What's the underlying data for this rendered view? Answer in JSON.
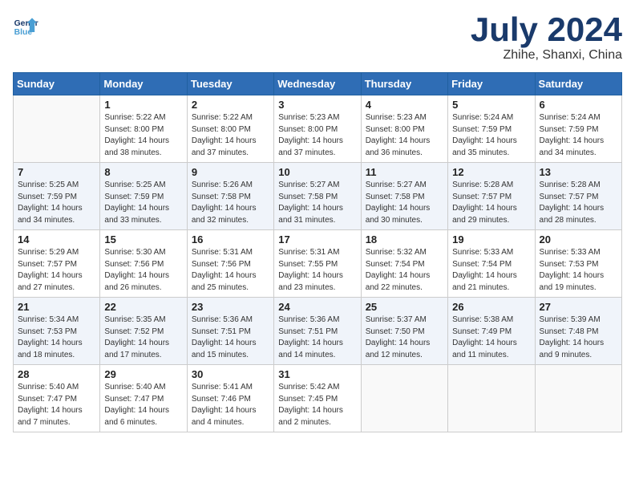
{
  "header": {
    "logo_line1": "General",
    "logo_line2": "Blue",
    "title": "July 2024",
    "subtitle": "Zhihe, Shanxi, China"
  },
  "days_of_week": [
    "Sunday",
    "Monday",
    "Tuesday",
    "Wednesday",
    "Thursday",
    "Friday",
    "Saturday"
  ],
  "weeks": [
    [
      {
        "day": "",
        "info": ""
      },
      {
        "day": "1",
        "info": "Sunrise: 5:22 AM\nSunset: 8:00 PM\nDaylight: 14 hours\nand 38 minutes."
      },
      {
        "day": "2",
        "info": "Sunrise: 5:22 AM\nSunset: 8:00 PM\nDaylight: 14 hours\nand 37 minutes."
      },
      {
        "day": "3",
        "info": "Sunrise: 5:23 AM\nSunset: 8:00 PM\nDaylight: 14 hours\nand 37 minutes."
      },
      {
        "day": "4",
        "info": "Sunrise: 5:23 AM\nSunset: 8:00 PM\nDaylight: 14 hours\nand 36 minutes."
      },
      {
        "day": "5",
        "info": "Sunrise: 5:24 AM\nSunset: 7:59 PM\nDaylight: 14 hours\nand 35 minutes."
      },
      {
        "day": "6",
        "info": "Sunrise: 5:24 AM\nSunset: 7:59 PM\nDaylight: 14 hours\nand 34 minutes."
      }
    ],
    [
      {
        "day": "7",
        "info": "Sunrise: 5:25 AM\nSunset: 7:59 PM\nDaylight: 14 hours\nand 34 minutes."
      },
      {
        "day": "8",
        "info": "Sunrise: 5:25 AM\nSunset: 7:59 PM\nDaylight: 14 hours\nand 33 minutes."
      },
      {
        "day": "9",
        "info": "Sunrise: 5:26 AM\nSunset: 7:58 PM\nDaylight: 14 hours\nand 32 minutes."
      },
      {
        "day": "10",
        "info": "Sunrise: 5:27 AM\nSunset: 7:58 PM\nDaylight: 14 hours\nand 31 minutes."
      },
      {
        "day": "11",
        "info": "Sunrise: 5:27 AM\nSunset: 7:58 PM\nDaylight: 14 hours\nand 30 minutes."
      },
      {
        "day": "12",
        "info": "Sunrise: 5:28 AM\nSunset: 7:57 PM\nDaylight: 14 hours\nand 29 minutes."
      },
      {
        "day": "13",
        "info": "Sunrise: 5:28 AM\nSunset: 7:57 PM\nDaylight: 14 hours\nand 28 minutes."
      }
    ],
    [
      {
        "day": "14",
        "info": "Sunrise: 5:29 AM\nSunset: 7:57 PM\nDaylight: 14 hours\nand 27 minutes."
      },
      {
        "day": "15",
        "info": "Sunrise: 5:30 AM\nSunset: 7:56 PM\nDaylight: 14 hours\nand 26 minutes."
      },
      {
        "day": "16",
        "info": "Sunrise: 5:31 AM\nSunset: 7:56 PM\nDaylight: 14 hours\nand 25 minutes."
      },
      {
        "day": "17",
        "info": "Sunrise: 5:31 AM\nSunset: 7:55 PM\nDaylight: 14 hours\nand 23 minutes."
      },
      {
        "day": "18",
        "info": "Sunrise: 5:32 AM\nSunset: 7:54 PM\nDaylight: 14 hours\nand 22 minutes."
      },
      {
        "day": "19",
        "info": "Sunrise: 5:33 AM\nSunset: 7:54 PM\nDaylight: 14 hours\nand 21 minutes."
      },
      {
        "day": "20",
        "info": "Sunrise: 5:33 AM\nSunset: 7:53 PM\nDaylight: 14 hours\nand 19 minutes."
      }
    ],
    [
      {
        "day": "21",
        "info": "Sunrise: 5:34 AM\nSunset: 7:53 PM\nDaylight: 14 hours\nand 18 minutes."
      },
      {
        "day": "22",
        "info": "Sunrise: 5:35 AM\nSunset: 7:52 PM\nDaylight: 14 hours\nand 17 minutes."
      },
      {
        "day": "23",
        "info": "Sunrise: 5:36 AM\nSunset: 7:51 PM\nDaylight: 14 hours\nand 15 minutes."
      },
      {
        "day": "24",
        "info": "Sunrise: 5:36 AM\nSunset: 7:51 PM\nDaylight: 14 hours\nand 14 minutes."
      },
      {
        "day": "25",
        "info": "Sunrise: 5:37 AM\nSunset: 7:50 PM\nDaylight: 14 hours\nand 12 minutes."
      },
      {
        "day": "26",
        "info": "Sunrise: 5:38 AM\nSunset: 7:49 PM\nDaylight: 14 hours\nand 11 minutes."
      },
      {
        "day": "27",
        "info": "Sunrise: 5:39 AM\nSunset: 7:48 PM\nDaylight: 14 hours\nand 9 minutes."
      }
    ],
    [
      {
        "day": "28",
        "info": "Sunrise: 5:40 AM\nSunset: 7:47 PM\nDaylight: 14 hours\nand 7 minutes."
      },
      {
        "day": "29",
        "info": "Sunrise: 5:40 AM\nSunset: 7:47 PM\nDaylight: 14 hours\nand 6 minutes."
      },
      {
        "day": "30",
        "info": "Sunrise: 5:41 AM\nSunset: 7:46 PM\nDaylight: 14 hours\nand 4 minutes."
      },
      {
        "day": "31",
        "info": "Sunrise: 5:42 AM\nSunset: 7:45 PM\nDaylight: 14 hours\nand 2 minutes."
      },
      {
        "day": "",
        "info": ""
      },
      {
        "day": "",
        "info": ""
      },
      {
        "day": "",
        "info": ""
      }
    ]
  ]
}
